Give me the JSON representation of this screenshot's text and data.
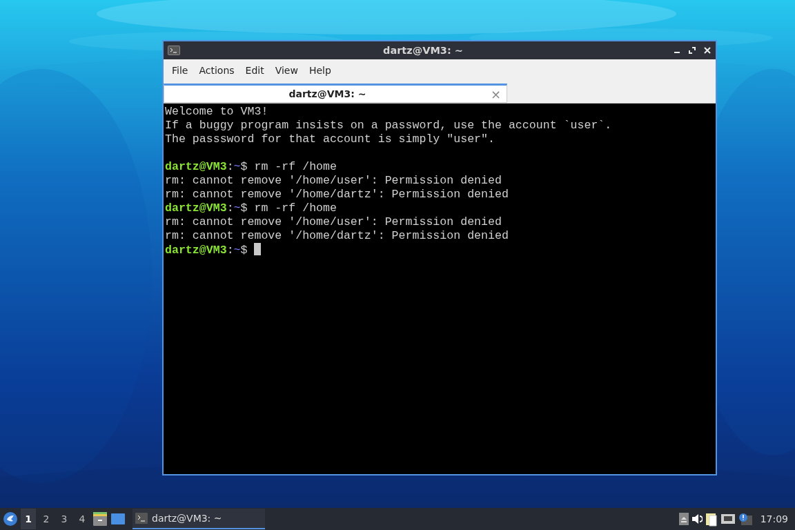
{
  "window": {
    "title": "dartz@VM3: ~",
    "focused": true
  },
  "menu": [
    "File",
    "Actions",
    "Edit",
    "View",
    "Help"
  ],
  "tabs": [
    {
      "label": "dartz@VM3: ~",
      "selected": true,
      "close": "×"
    }
  ],
  "terminal": {
    "lines": [
      {
        "kind": "output",
        "text": "Welcome to VM3!"
      },
      {
        "kind": "output",
        "text": "If a buggy program insists on a password, use the account `user`."
      },
      {
        "kind": "output",
        "text": "The passsword for that account is simply \"user\"."
      },
      {
        "kind": "blank"
      },
      {
        "kind": "prompt",
        "user": "dartz@VM3",
        "sep": ":",
        "path": "~",
        "sign": "$",
        "command": " rm -rf /home"
      },
      {
        "kind": "output",
        "text": "rm: cannot remove '/home/user': Permission denied"
      },
      {
        "kind": "output",
        "text": "rm: cannot remove '/home/dartz': Permission denied"
      },
      {
        "kind": "prompt",
        "user": "dartz@VM3",
        "sep": ":",
        "path": "~",
        "sign": "$",
        "command": " rm -rf /home"
      },
      {
        "kind": "output",
        "text": "rm: cannot remove '/home/user': Permission denied"
      },
      {
        "kind": "output",
        "text": "rm: cannot remove '/home/dartz': Permission denied"
      },
      {
        "kind": "prompt",
        "user": "dartz@VM3",
        "sep": ":",
        "path": "~",
        "sign": "$",
        "cursor": true
      }
    ]
  },
  "taskbar": {
    "workspaces": [
      {
        "label": "1",
        "selected": true
      },
      {
        "label": "2",
        "selected": false
      },
      {
        "label": "3",
        "selected": false
      },
      {
        "label": "4",
        "selected": false
      }
    ],
    "tasks": [
      {
        "label": "dartz@VM3: ~",
        "selected": true
      }
    ],
    "clock": "17:09"
  }
}
